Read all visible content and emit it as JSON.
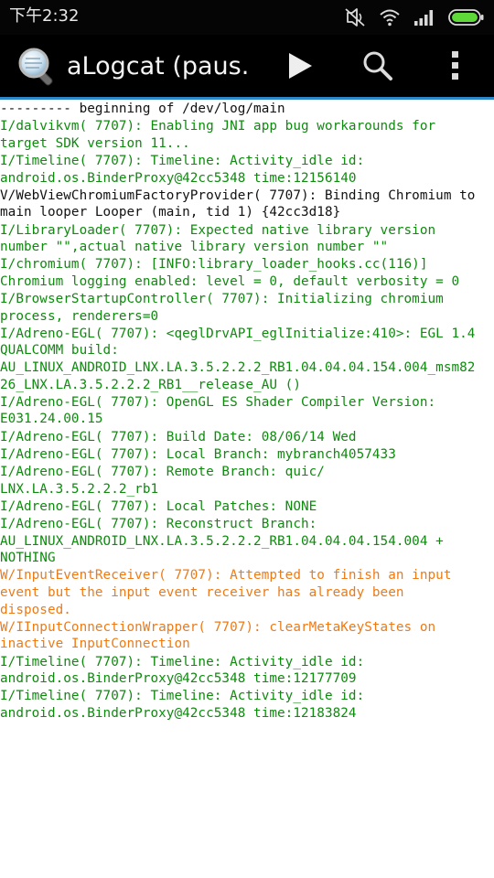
{
  "status_bar": {
    "time": "下午2:32",
    "icons": [
      "mute-icon",
      "wifi-icon",
      "signal-icon",
      "battery-icon"
    ]
  },
  "action_bar": {
    "title": "aLogcat (paus.",
    "icons": [
      "app-magnifier-icon",
      "play-icon",
      "search-icon",
      "overflow-menu-icon"
    ]
  },
  "colors": {
    "info": "#0f8a0f",
    "verbose": "#111111",
    "warning": "#ee7a16",
    "accent": "#2c88c8"
  },
  "log": {
    "entries": [
      {
        "level": "header",
        "lines": [
          "--------- beginning of /dev/log/main"
        ]
      },
      {
        "level": "I",
        "lines": [
          "I/dalvikvm( 7707): Enabling JNI app bug workarounds for",
          "target SDK version 11..."
        ]
      },
      {
        "level": "I",
        "lines": [
          "I/Timeline( 7707): Timeline: Activity_idle id:",
          "android.os.BinderProxy@42cc5348 time:12156140"
        ]
      },
      {
        "level": "V",
        "lines": [
          "V/WebViewChromiumFactoryProvider( 7707): Binding Chromium to",
          "main looper Looper (main, tid 1) {42cc3d18}"
        ]
      },
      {
        "level": "I",
        "lines": [
          "I/LibraryLoader( 7707): Expected native library version",
          "number \"\",actual native library version number \"\""
        ]
      },
      {
        "level": "I",
        "lines": [
          "I/chromium( 7707): [INFO:library_loader_hooks.cc(116)]",
          "Chromium logging enabled: level = 0, default verbosity = 0"
        ]
      },
      {
        "level": "I",
        "lines": [
          "I/BrowserStartupController( 7707): Initializing chromium",
          "process, renderers=0"
        ]
      },
      {
        "level": "I",
        "lines": [
          "I/Adreno-EGL( 7707): <qeglDrvAPI_eglInitialize:410>: EGL 1.4",
          "QUALCOMM build:",
          "AU_LINUX_ANDROID_LNX.LA.3.5.2.2.2_RB1.04.04.04.154.004_msm82",
          "26_LNX.LA.3.5.2.2.2_RB1__release_AU ()"
        ]
      },
      {
        "level": "I",
        "lines": [
          "I/Adreno-EGL( 7707): OpenGL ES Shader Compiler Version:",
          "E031.24.00.15"
        ]
      },
      {
        "level": "I",
        "lines": [
          "I/Adreno-EGL( 7707): Build Date: 08/06/14 Wed"
        ]
      },
      {
        "level": "I",
        "lines": [
          "I/Adreno-EGL( 7707): Local Branch: mybranch4057433"
        ]
      },
      {
        "level": "I",
        "lines": [
          "I/Adreno-EGL( 7707): Remote Branch: quic/",
          "LNX.LA.3.5.2.2.2_rb1"
        ]
      },
      {
        "level": "I",
        "lines": [
          "I/Adreno-EGL( 7707): Local Patches: NONE"
        ]
      },
      {
        "level": "I",
        "lines": [
          "I/Adreno-EGL( 7707): Reconstruct Branch:",
          "AU_LINUX_ANDROID_LNX.LA.3.5.2.2.2_RB1.04.04.04.154.004 +",
          "NOTHING"
        ]
      },
      {
        "level": "W",
        "lines": [
          "W/InputEventReceiver( 7707): Attempted to finish an input",
          "event but the input event receiver has already been",
          "disposed."
        ]
      },
      {
        "level": "W",
        "lines": [
          "W/IInputConnectionWrapper( 7707): clearMetaKeyStates on",
          "inactive InputConnection"
        ]
      },
      {
        "level": "I",
        "lines": [
          "I/Timeline( 7707): Timeline: Activity_idle id:",
          "android.os.BinderProxy@42cc5348 time:12177709"
        ]
      },
      {
        "level": "I",
        "lines": [
          "I/Timeline( 7707): Timeline: Activity_idle id:",
          "android.os.BinderProxy@42cc5348 time:12183824"
        ]
      }
    ]
  }
}
